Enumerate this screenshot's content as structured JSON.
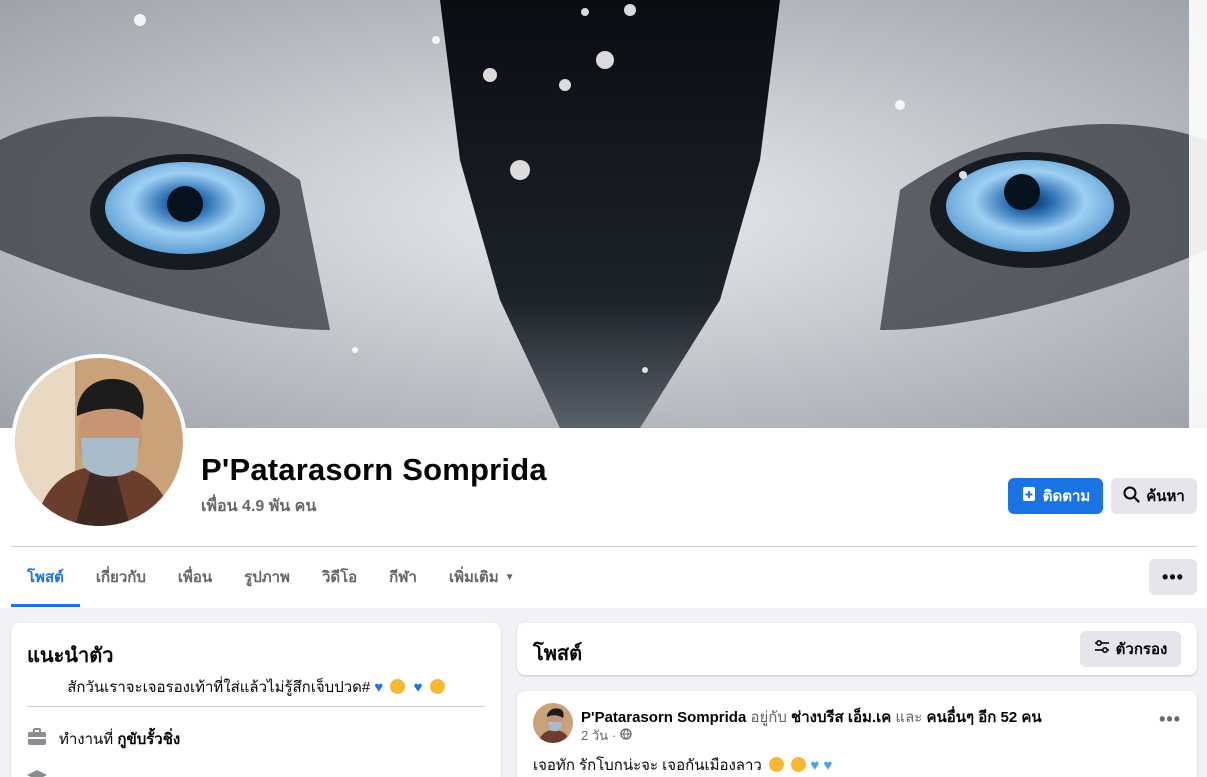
{
  "profile": {
    "name": "P'Patarasorn Somprida",
    "friends": "เพื่อน 4.9 พัน คน"
  },
  "actions": {
    "follow_label": "ติดตาม",
    "search_label": "ค้นหา",
    "accent": "#1b74e4"
  },
  "tabs": [
    {
      "label": "โพสต์",
      "active": true
    },
    {
      "label": "เกี่ยวกับ"
    },
    {
      "label": "เพื่อน"
    },
    {
      "label": "รูปภาพ"
    },
    {
      "label": "วิดีโอ"
    },
    {
      "label": "กีฬา"
    },
    {
      "label": "เพิ่มเติม"
    }
  ],
  "intro": {
    "title": "แนะนำตัว",
    "bio": "สักวันเราจะเจอรองเท้าที่ใส่แล้วไม่รู้สึกเจ็บปวด#",
    "work_prefix": "ทำงานที่",
    "work_place": "กูขับรั้วชิ่ง"
  },
  "posts": {
    "title": "โพสต์",
    "filter_label": "ตัวกรอง"
  },
  "post": {
    "author": "P'Patarasorn Somprida",
    "with_text": "อยู่กับ",
    "tagged": "ช่างบรีส เอ็ม.เค",
    "and_text": "และ",
    "others": "คนอื่นๆ อีก 52 คน",
    "time": "2 วัน",
    "text": "เจอทัก รักโบกน่ะจะ เจอกันเมืองลาว"
  },
  "icons": {
    "follow": "add-friend-icon",
    "search": "search-icon",
    "more": "ellipsis-icon",
    "filter": "filter-icon",
    "work": "briefcase-icon",
    "privacy": "globe-icon"
  }
}
